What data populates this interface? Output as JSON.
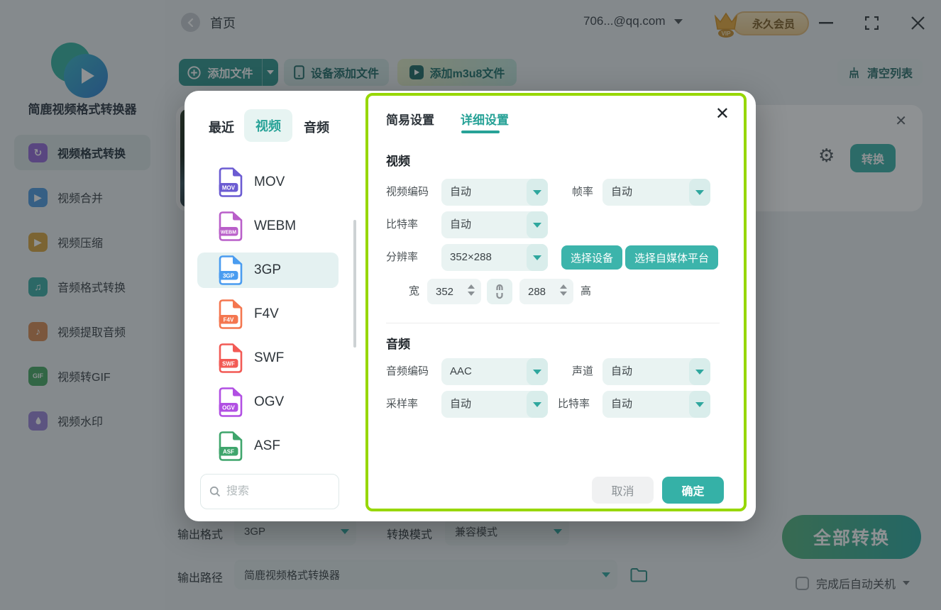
{
  "titlebar": {
    "home": "首页",
    "account": "706...@qq.com",
    "vip_tag": "VIP",
    "vip_badge": "永久会员"
  },
  "sidebar": {
    "app_name": "简鹿视频格式转换器",
    "items": [
      {
        "label": "视频格式转换",
        "active": true,
        "icon": "convert-icon",
        "color": "#9468d8",
        "glyph": "↻"
      },
      {
        "label": "视频合并",
        "active": false,
        "icon": "merge-icon",
        "color": "#4f9be0",
        "glyph": "▶"
      },
      {
        "label": "视频压缩",
        "active": false,
        "icon": "compress-icon",
        "color": "#d9a53f",
        "glyph": "▶"
      },
      {
        "label": "音频格式转换",
        "active": false,
        "icon": "audio-convert-icon",
        "color": "#3bada4",
        "glyph": "♫"
      },
      {
        "label": "视频提取音频",
        "active": false,
        "icon": "extract-audio-icon",
        "color": "#d88a52",
        "glyph": "♪"
      },
      {
        "label": "视频转GIF",
        "active": false,
        "icon": "gif-icon",
        "color": "#47a863",
        "glyph": "GIF"
      },
      {
        "label": "视频水印",
        "active": false,
        "icon": "watermark-icon",
        "color": "#9b84d8",
        "glyph": "●"
      }
    ]
  },
  "toolbar": {
    "add_file": "添加文件",
    "add_from_device": "设备添加文件",
    "add_m3u8": "添加m3u8文件",
    "clear_list": "清空列表"
  },
  "file_card": {
    "convert": "转换"
  },
  "format_picker": {
    "tabs": {
      "recent": "最近",
      "video": "视频",
      "audio": "音频"
    },
    "formats": [
      {
        "name": "MOV",
        "color": "#6b5bd2"
      },
      {
        "name": "WEBM",
        "color": "#b95fc9"
      },
      {
        "name": "3GP",
        "color": "#4a9cf0",
        "selected": true
      },
      {
        "name": "F4V",
        "color": "#f4764f"
      },
      {
        "name": "SWF",
        "color": "#f25a55"
      },
      {
        "name": "OGV",
        "color": "#b14fe3"
      },
      {
        "name": "ASF",
        "color": "#3fa56c"
      }
    ],
    "search_placeholder": "搜索"
  },
  "settings": {
    "tab_simple": "简易设置",
    "tab_detail": "详细设置",
    "video": {
      "title": "视频",
      "codec_label": "视频编码",
      "codec_value": "自动",
      "fps_label": "帧率",
      "fps_value": "自动",
      "bitrate_label": "比特率",
      "bitrate_value": "自动",
      "resolution_label": "分辨率",
      "resolution_value": "352×288",
      "select_device": "选择设备",
      "select_platform": "选择自媒体平台",
      "width_label": "宽",
      "width_value": "352",
      "height_label": "高",
      "height_value": "288"
    },
    "audio": {
      "title": "音频",
      "codec_label": "音频编码",
      "codec_value": "AAC",
      "channel_label": "声道",
      "channel_value": "自动",
      "sample_label": "采样率",
      "sample_value": "自动",
      "bitrate_label": "比特率",
      "bitrate_value": "自动"
    },
    "cancel": "取消",
    "ok": "确定"
  },
  "bottom": {
    "output_format_label": "输出格式",
    "output_format_value": "3GP",
    "convert_mode_label": "转换模式",
    "convert_mode_value": "兼容模式",
    "output_path_label": "输出路径",
    "output_path_value": "简鹿视频格式转换器",
    "convert_all": "全部转换",
    "auto_shutdown": "完成后自动关机"
  },
  "colors": {
    "accent": "#35b1a7",
    "panel_border": "#97d703"
  }
}
